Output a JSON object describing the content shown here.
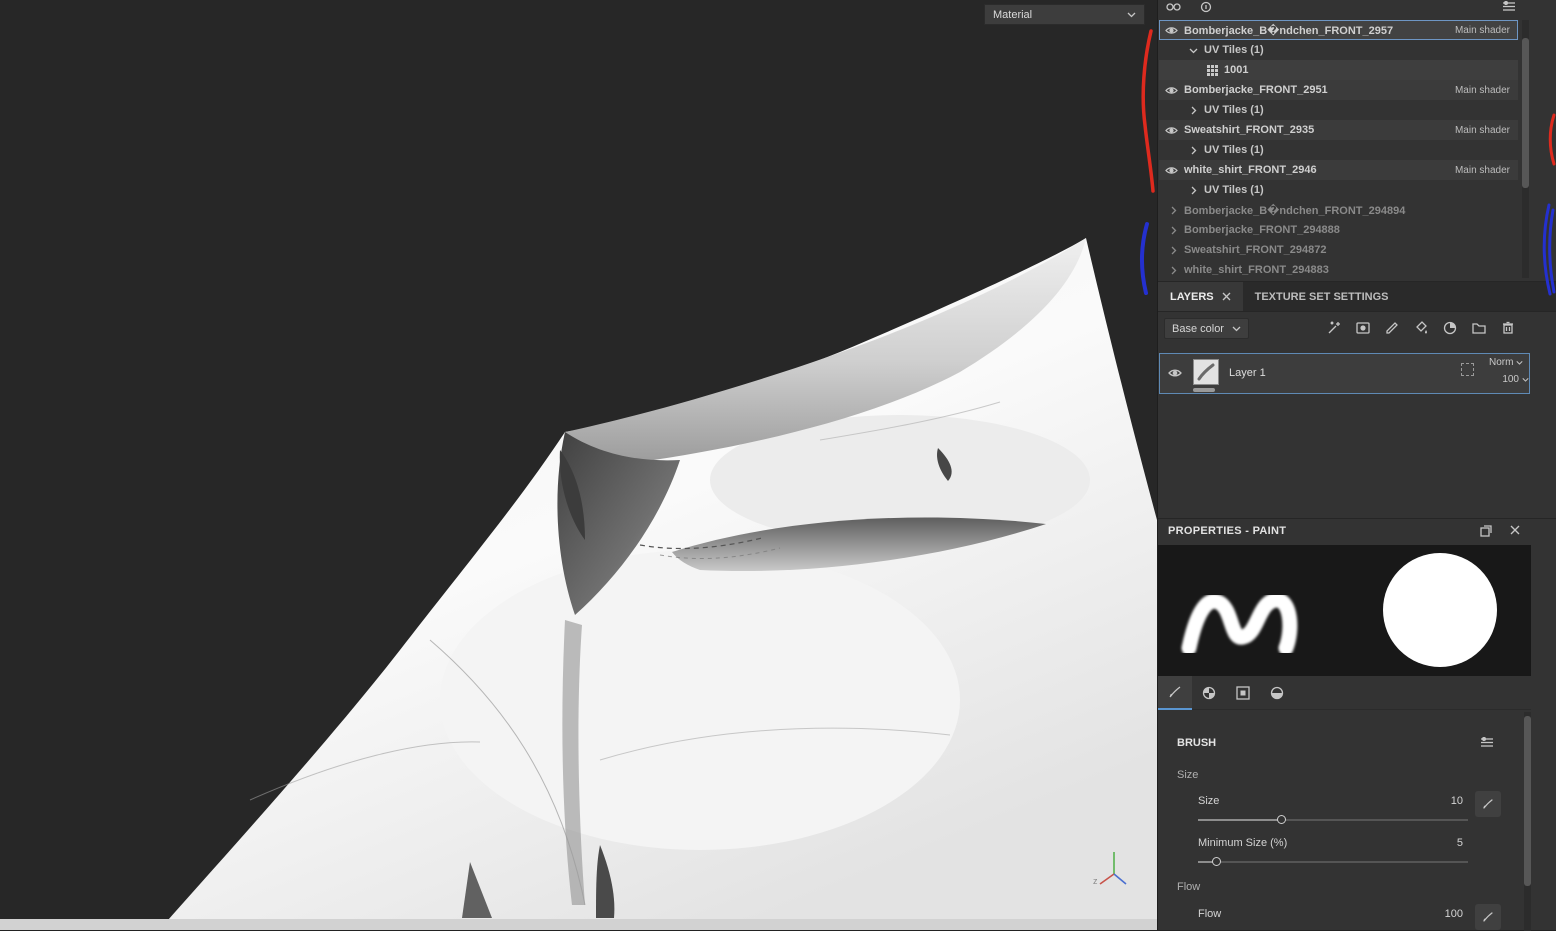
{
  "viewport": {
    "material_dropdown": {
      "value": "Material"
    },
    "gizmo_z_label": "z"
  },
  "texture_set_list": {
    "rows": [
      {
        "kind": "set",
        "name": "Bomberjacke_B�ndchen_FRONT_2957",
        "shader": "Main shader",
        "selected": true
      },
      {
        "kind": "uv",
        "label": "UV Tiles (1)",
        "expanded": true
      },
      {
        "kind": "tile",
        "label": "1001"
      },
      {
        "kind": "set",
        "name": "Bomberjacke_FRONT_2951",
        "shader": "Main shader"
      },
      {
        "kind": "uv",
        "label": "UV Tiles (1)"
      },
      {
        "kind": "set",
        "name": "Sweatshirt_FRONT_2935",
        "shader": "Main shader"
      },
      {
        "kind": "uv",
        "label": "UV Tiles (1)"
      },
      {
        "kind": "set",
        "name": "white_shirt_FRONT_2946",
        "shader": "Main shader"
      },
      {
        "kind": "uv",
        "label": "UV Tiles (1)"
      },
      {
        "kind": "hidden",
        "name": "Bomberjacke_B�ndchen_FRONT_294894"
      },
      {
        "kind": "hidden",
        "name": "Bomberjacke_FRONT_294888"
      },
      {
        "kind": "hidden",
        "name": "Sweatshirt_FRONT_294872"
      },
      {
        "kind": "hidden",
        "name": "white_shirt_FRONT_294883"
      }
    ]
  },
  "tabs": {
    "layers_label": "LAYERS",
    "texture_set_settings_label": "TEXTURE SET SETTINGS"
  },
  "layers_panel": {
    "channel_filter": "Base color",
    "layer": {
      "name": "Layer 1",
      "blend_mode": "Norm",
      "opacity": "100"
    }
  },
  "properties_panel": {
    "title": "PROPERTIES - PAINT",
    "section_brush": "BRUSH",
    "size_group": "Size",
    "size_label": "Size",
    "size_value": "10",
    "min_size_label": "Minimum Size (%)",
    "min_size_value": "5",
    "flow_group": "Flow",
    "flow_label": "Flow",
    "flow_value": "100"
  },
  "colors": {
    "accent_blue": "#5a96d2",
    "selection_border": "#6e96c4",
    "annotation_red": "#de2a1e",
    "annotation_blue": "#2430cf",
    "viewport_bg": "#272727",
    "panel_bg": "#333333"
  }
}
